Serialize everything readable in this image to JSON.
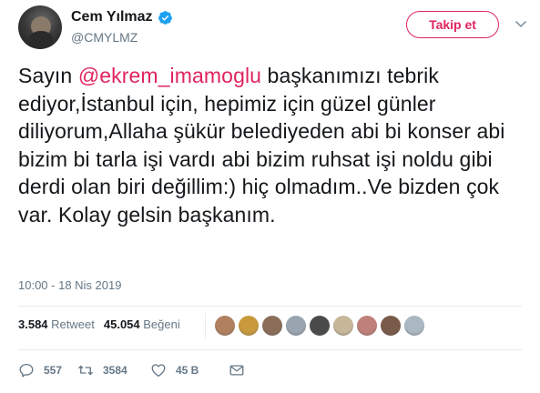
{
  "user": {
    "display_name": "Cem Yılmaz",
    "handle": "@CMYLMZ",
    "verified": true
  },
  "follow_button": {
    "label": "Takip et"
  },
  "tweet": {
    "text_before": "Sayın ",
    "mention": "@ekrem_imamoglu",
    "text_after": " başkanımızı tebrik ediyor,İstanbul için, hepimiz için güzel günler diliyorum,Allaha şükür belediyeden abi bi konser abi bizim bi tarla işi vardı abi bizim ruhsat işi noldu gibi derdi olan biri değillim:) hiç olmadım..Ve bizden çok var. Kolay gelsin başkanım.",
    "timestamp": "10:00 - 18 Nis 2019"
  },
  "stats": {
    "retweet_count": "3.584",
    "retweet_label": "Retweet",
    "like_count": "45.054",
    "like_label": "Beğeni"
  },
  "likers": [
    {
      "name": "liker-1",
      "color": "#b08060"
    },
    {
      "name": "liker-2",
      "color": "#c89a3c"
    },
    {
      "name": "liker-3",
      "color": "#8a6e5a"
    },
    {
      "name": "liker-4",
      "color": "#9aa5b1"
    },
    {
      "name": "liker-5",
      "color": "#4a4a4a"
    },
    {
      "name": "liker-6",
      "color": "#c7b89a"
    },
    {
      "name": "liker-7",
      "color": "#c0807a"
    },
    {
      "name": "liker-8",
      "color": "#7a5a4a"
    },
    {
      "name": "liker-9",
      "color": "#aab8c2"
    }
  ],
  "actions": {
    "reply_count": "557",
    "retweet_count": "3584",
    "like_count": "45 B"
  },
  "colors": {
    "accent": "#e0245e",
    "verified": "#1da1f2",
    "secondary_text": "#657786"
  }
}
